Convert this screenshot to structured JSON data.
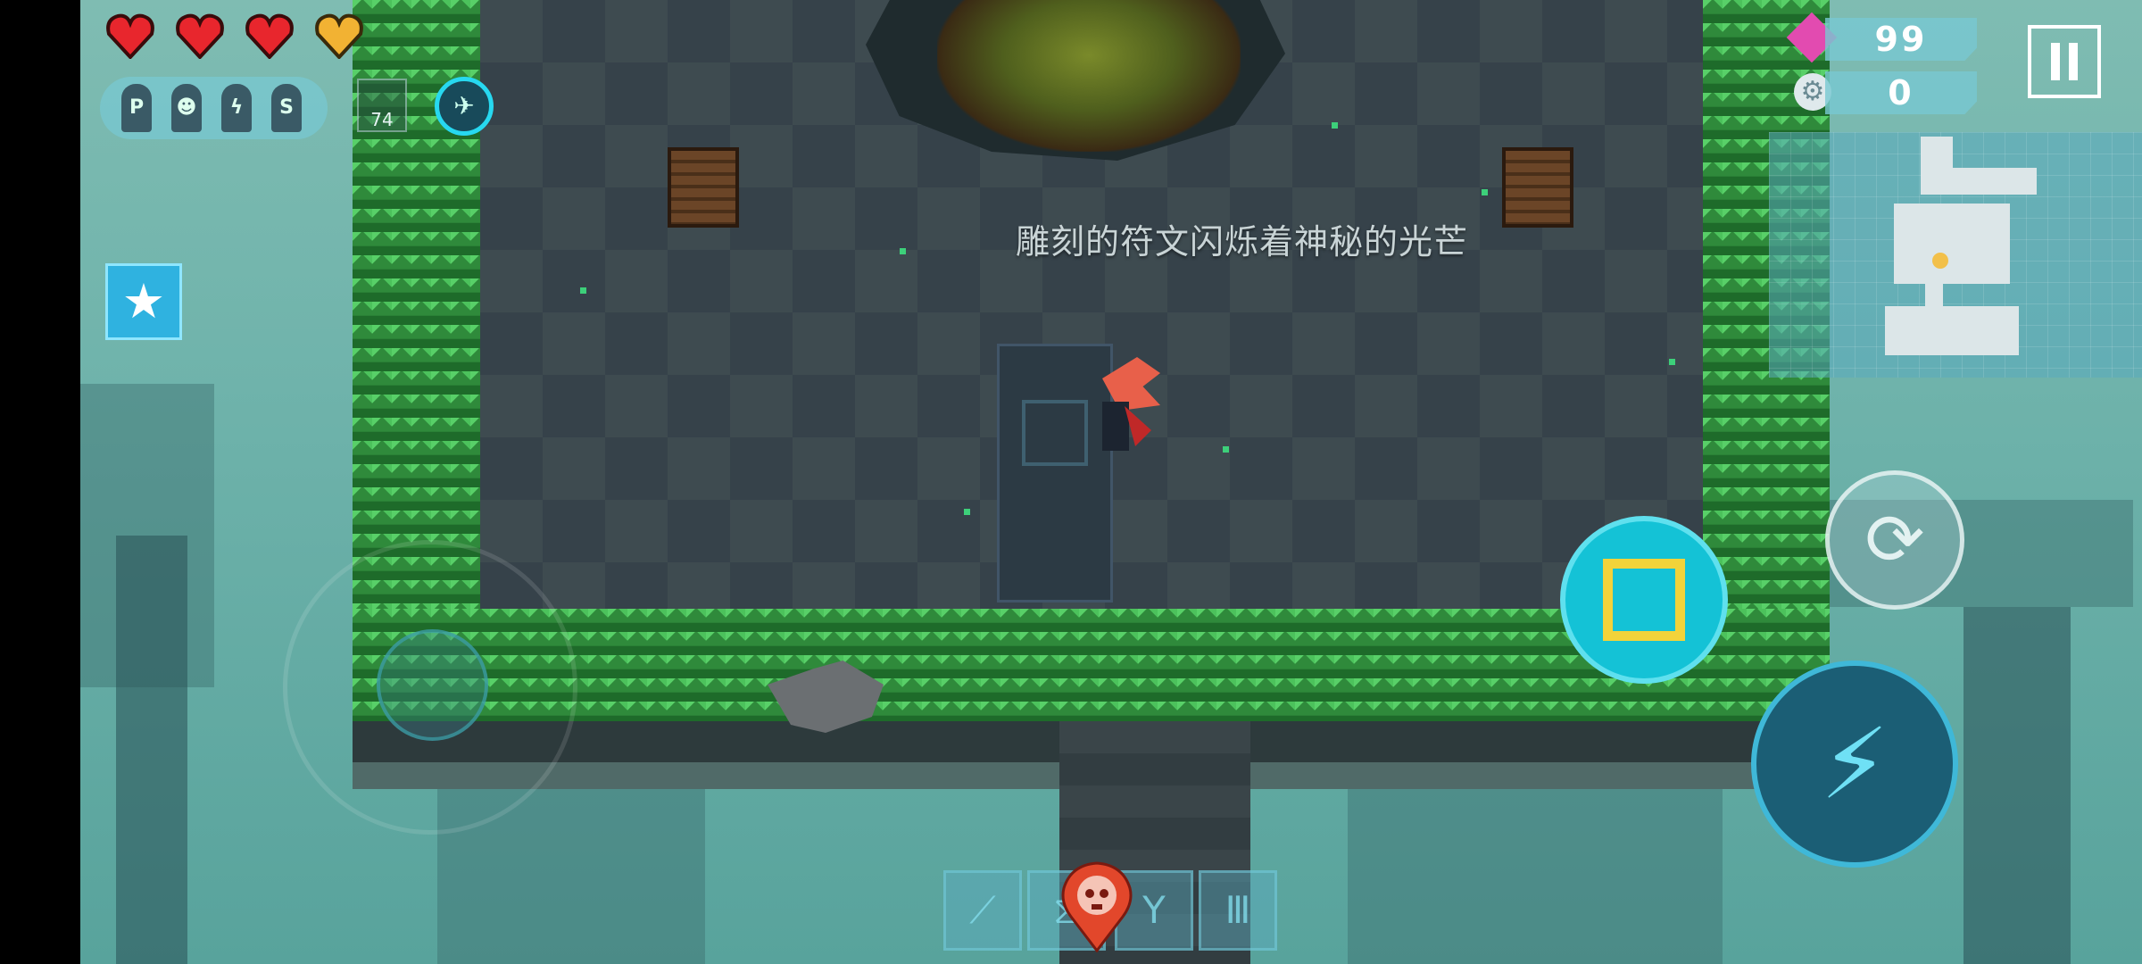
{
  "hud": {
    "hearts": [
      {
        "name": "heart-full",
        "color": "#e8262d"
      },
      {
        "name": "heart-full",
        "color": "#e8262d"
      },
      {
        "name": "heart-full",
        "color": "#e8262d"
      },
      {
        "name": "heart-armor",
        "color": "#f2b233"
      }
    ],
    "perks": [
      "P",
      "",
      "",
      "S"
    ],
    "weapon_ammo": "74",
    "gems": "99",
    "parts": "0"
  },
  "message": "雕刻的符文闪烁着神秘的光芒",
  "icons": {
    "pause": "pause-icon",
    "gem": "gem-icon",
    "parts": "gear-icon",
    "skill": "skill-icon",
    "swap": "swap-weapon-icon",
    "attack": "attack-icon",
    "buff": "star-icon",
    "boss_marker": "skull-marker-icon"
  },
  "colors": {
    "accent": "#14c2d6",
    "gem": "#e24bb0",
    "grass": "#3fb34f"
  }
}
